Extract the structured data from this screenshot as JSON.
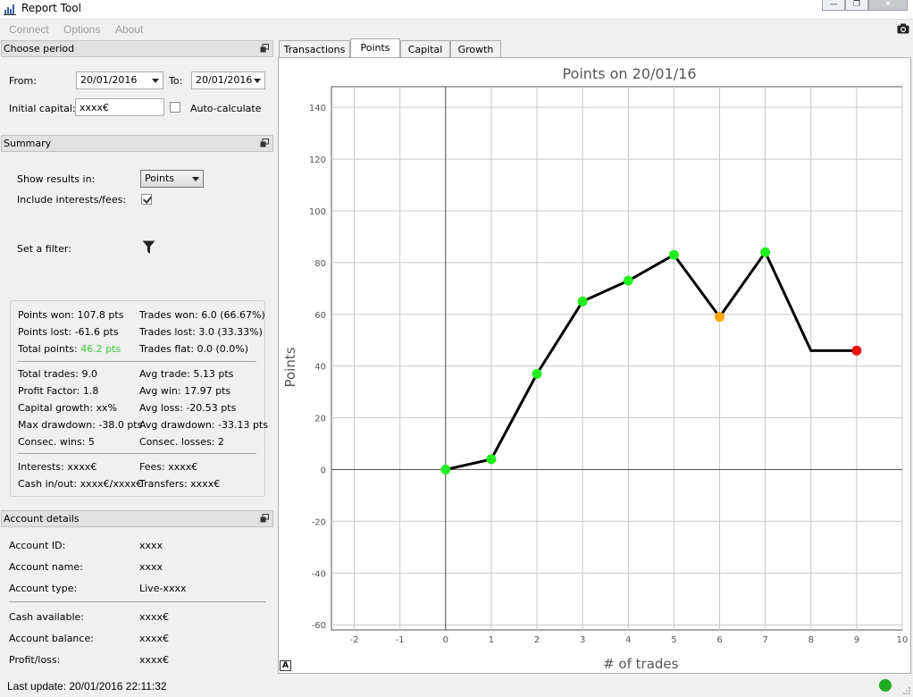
{
  "window": {
    "title": "Report Tool"
  },
  "menu": [
    "Connect",
    "Options",
    "About"
  ],
  "choose_period": {
    "header": "Choose period",
    "from_label": "From:",
    "from_value": "20/01/2016",
    "to_label": "To:",
    "to_value": "20/01/2016",
    "capital_label": "Initial capital:",
    "capital_value": "xxxx€",
    "auto_label": "Auto-calculate"
  },
  "summary": {
    "header": "Summary",
    "show_label": "Show results in:",
    "show_value": "Points",
    "include_label": "Include interests/fees:",
    "filter_label": "Set a filter:",
    "stats": {
      "points_won": "Points won: 107.8 pts",
      "points_lost": "Points lost: -61.6 pts",
      "total_points_label": "Total points: ",
      "total_points_value": "46.2 pts",
      "trades_won": "Trades won: 6.0 (66.67%)",
      "trades_lost": "Trades lost: 3.0 (33.33%)",
      "trades_flat": "Trades flat: 0.0 (0.0%)",
      "total_trades": "Total trades: 9.0",
      "profit_factor": "Profit Factor: 1.8",
      "capital_growth": "Capital growth: xx%",
      "max_drawdown": "Max drawdown: -38.0 pts",
      "consec_wins": "Consec. wins: 5",
      "avg_trade": "Avg trade: 5.13 pts",
      "avg_win": "Avg win: 17.97 pts",
      "avg_loss": "Avg loss: -20.53 pts",
      "avg_drawdown": "Avg drawdown: -33.13 pts",
      "consec_losses": "Consec. losses: 2",
      "interests": "Interests: xxxx€",
      "cash_inout": "Cash in/out: xxxx€/xxxx€",
      "fees": "Fees: xxxx€",
      "transfers": "Transfers: xxxx€"
    }
  },
  "account": {
    "header": "Account details",
    "rows": [
      {
        "label": "Account ID:",
        "value": "xxxx"
      },
      {
        "label": "Account name:",
        "value": "xxxx"
      },
      {
        "label": "Account type:",
        "value": "Live-xxxx"
      },
      {
        "label": "Cash available:",
        "value": "xxxx€"
      },
      {
        "label": "Account balance:",
        "value": "xxxx€"
      },
      {
        "label": "Profit/loss:",
        "value": "xxxx€"
      }
    ]
  },
  "tabs": [
    "Transactions",
    "Points",
    "Capital",
    "Growth"
  ],
  "active_tab": "Points",
  "auto_scale_label": "A",
  "status": {
    "text": "Last update: 20/01/2016 22:11:32",
    "indicator_color": "#22aa22"
  },
  "chart_data": {
    "type": "line",
    "title": "Points on 20/01/16",
    "xlabel": "# of trades",
    "ylabel": "Points",
    "xlim": [
      -2.5,
      10
    ],
    "ylim": [
      -62,
      148
    ],
    "xticks": [
      -2,
      -1,
      0,
      1,
      2,
      3,
      4,
      5,
      6,
      7,
      8,
      9,
      10
    ],
    "yticks": [
      -60,
      -40,
      -20,
      0,
      20,
      40,
      60,
      80,
      100,
      120,
      140
    ],
    "grid": true,
    "x": [
      0,
      1,
      2,
      3,
      4,
      5,
      6,
      7,
      8,
      9
    ],
    "y": [
      0,
      4,
      37,
      65,
      73,
      83,
      59,
      84,
      46,
      46
    ],
    "marker_colors": [
      "#22ee22",
      "#22ee22",
      "#22ee22",
      "#22ee22",
      "#22ee22",
      "#22ee22",
      "#ffa500",
      "#22ee22",
      null,
      "#ee1111"
    ],
    "line_color": "#000000"
  }
}
